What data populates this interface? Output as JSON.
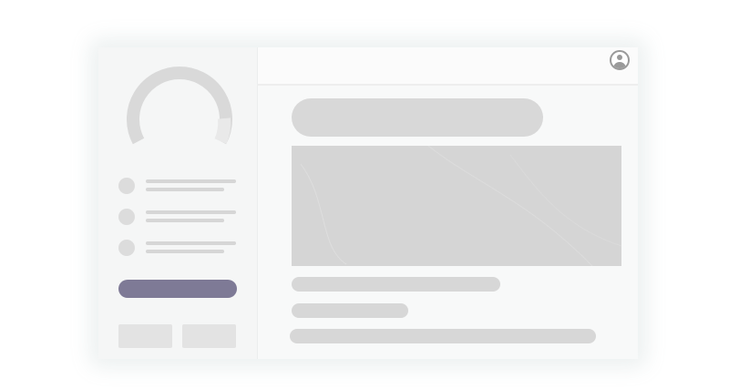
{
  "app": {
    "type": "loading-skeleton-mockup"
  },
  "header": {
    "profile_icon": "user-circle-icon"
  },
  "sidebar": {
    "gauge_icon": "progress-ring-icon",
    "list_items": [
      {
        "icon": "placeholder-circle-icon"
      },
      {
        "icon": "placeholder-circle-icon"
      },
      {
        "icon": "placeholder-circle-icon"
      }
    ],
    "primary_action_color": "#7e7a96"
  },
  "colors": {
    "background": "#ffffff",
    "window": "#f7f8f8",
    "skeleton": "#d7d7d7",
    "accent": "#7e7a96",
    "icon": "#9a9a9a"
  }
}
